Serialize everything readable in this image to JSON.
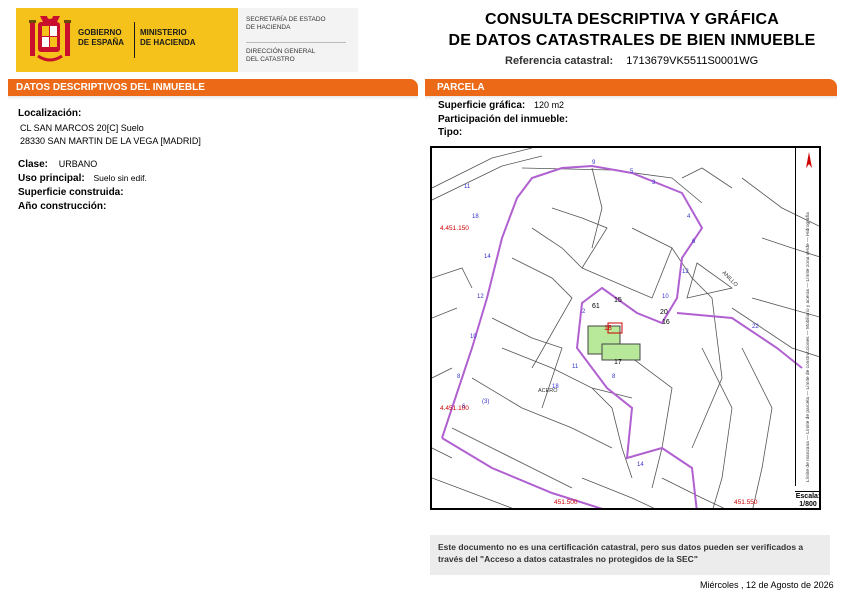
{
  "header": {
    "gov_line1": "GOBIERNO",
    "gov_line2": "DE ESPAÑA",
    "min_line1": "MINISTERIO",
    "min_line2": "DE HACIENDA",
    "sec_line1": "SECRETARÍA DE ESTADO",
    "sec_line2": "DE HACIENDA",
    "dir_line1": "DIRECCIÓN GENERAL",
    "dir_line2": "DEL CATASTRO",
    "title_line1": "CONSULTA DESCRIPTIVA Y GRÁFICA",
    "title_line2": "DE DATOS CATASTRALES DE BIEN INMUEBLE",
    "ref_label": "Referencia catastral:",
    "ref_value": "1713679VK5511S0001WG"
  },
  "left_panel": {
    "heading": "DATOS DESCRIPTIVOS DEL INMUEBLE",
    "localizacion_label": "Localización:",
    "address_line1": "CL SAN MARCOS 20[C] Suelo",
    "address_line2": "28330 SAN MARTIN DE LA VEGA [MADRID]",
    "clase_label": "Clase:",
    "clase_value": "URBANO",
    "uso_label": "Uso principal:",
    "uso_value": "Suelo sin edif.",
    "superficie_label": "Superficie construida:",
    "anio_label": "Año construcción:"
  },
  "right_panel": {
    "heading": "PARCELA",
    "superficie_label": "Superficie gráfica:",
    "superficie_value": "120 m2",
    "participacion_label": "Participación del inmueble:",
    "tipo_label": "Tipo:"
  },
  "map": {
    "coord_left_top": "4.451.150",
    "coord_left_mid": "4.451.100",
    "coord_bottom_1": "451.500",
    "coord_bottom_2": "451.550",
    "parcel_numbers": [
      "61",
      "15",
      "16",
      "17",
      "20",
      "18"
    ],
    "street_labels": [
      "ACERO",
      "ANILLO"
    ],
    "scale_label": "Escala:",
    "scale_value": "1/800",
    "legend_text": "Límite de manzana — Límite de parcela — Límite de construcciones — Mobiliario y aceras — Límite zona verde — Hidrografía"
  },
  "note": {
    "line1": "Este documento no es una certificación catastral, pero sus datos pueden ser verificados a",
    "line2": "través del \"Acceso a datos catastrales no protegidos de la SEC\""
  },
  "footer": {
    "date": "Miércoles , 12 de Agosto de 2026"
  },
  "colors": {
    "accent": "#ec6a17",
    "logo_yellow": "#f5c21b",
    "parcel_green": "#b8e89a",
    "block_purple": "#b060d0"
  }
}
